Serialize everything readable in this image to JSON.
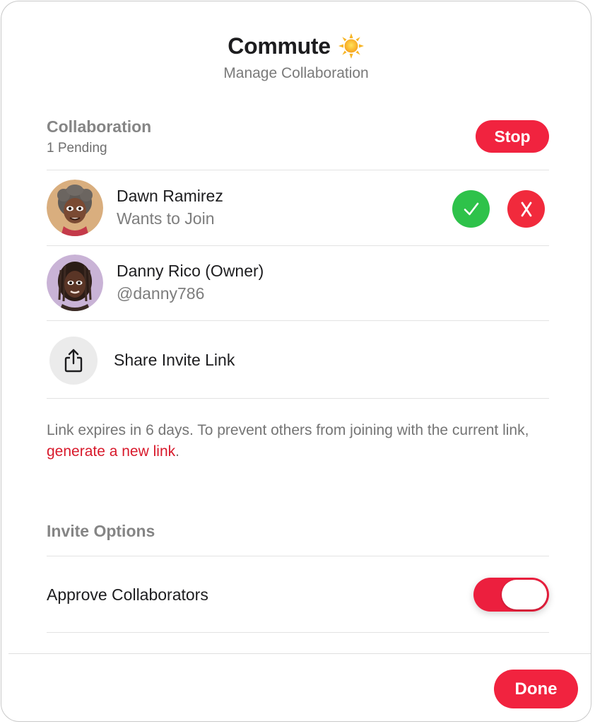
{
  "dialog": {
    "title": "Commute",
    "title_icon": "sun-icon",
    "subtitle": "Manage Collaboration"
  },
  "collaboration": {
    "heading": "Collaboration",
    "pending": "1 Pending",
    "stop_label": "Stop"
  },
  "participants": [
    {
      "name": "Dawn Ramirez",
      "status": "Wants to Join",
      "avatar": "memoji-avatar",
      "actions": [
        "approve-icon",
        "decline-icon"
      ]
    },
    {
      "name": "Danny Rico (Owner)",
      "status": "@danny786",
      "avatar": "memoji-avatar"
    }
  ],
  "share": {
    "label": "Share Invite Link",
    "icon": "share-icon"
  },
  "expiry": {
    "text": "Link expires in 6 days. To prevent others from joining with the current link, ",
    "link_text": "generate a new link",
    "suffix": "."
  },
  "invite_options": {
    "heading": "Invite Options",
    "approve_label": "Approve Collaborators",
    "approve_enabled": true
  },
  "footer": {
    "done_label": "Done"
  },
  "colors": {
    "accent": "#f1233f",
    "approve": "#2ec24a",
    "decline": "#f12a3c",
    "link": "#d8192b"
  }
}
